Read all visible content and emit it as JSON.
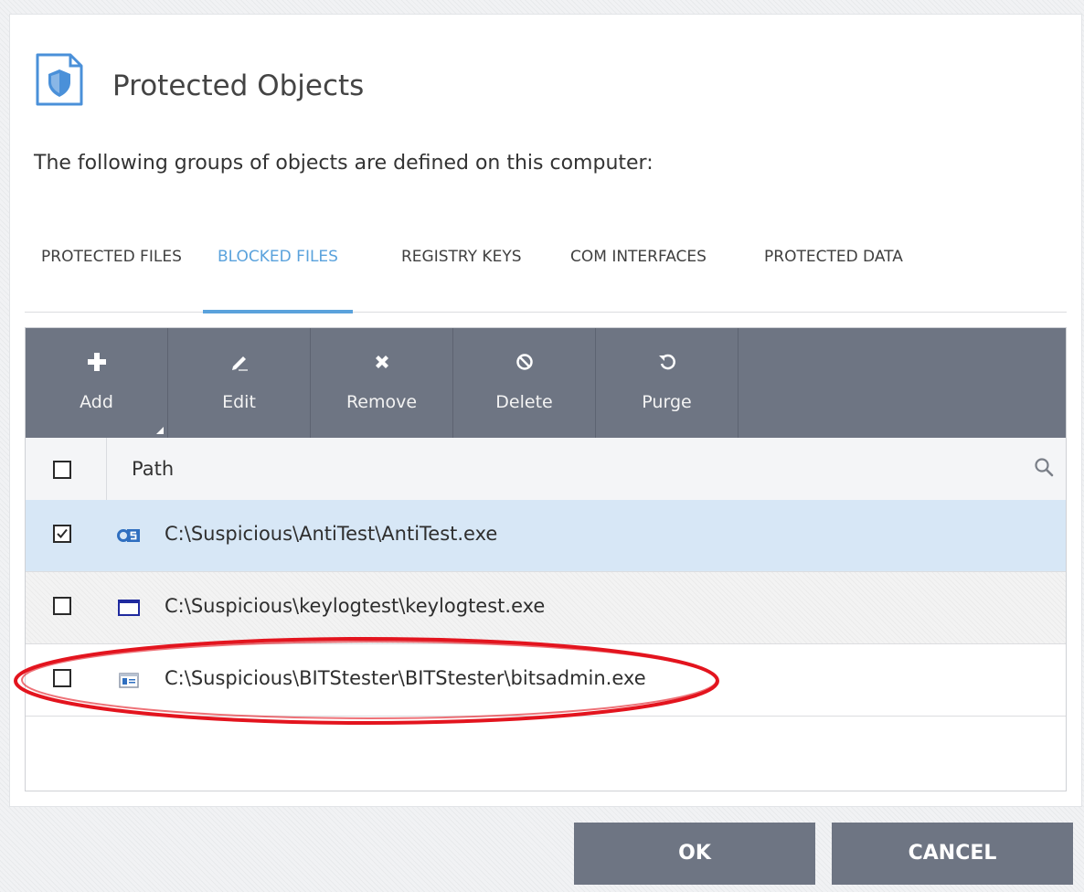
{
  "dialog": {
    "title": "Protected Objects",
    "subtitle": "The following groups of objects are defined on this computer:",
    "header_icon": "shield-document-icon"
  },
  "tabs": [
    {
      "label": "PROTECTED FILES",
      "active": false
    },
    {
      "label": "BLOCKED FILES",
      "active": true
    },
    {
      "label": "REGISTRY KEYS",
      "active": false
    },
    {
      "label": "COM INTERFACES",
      "active": false
    },
    {
      "label": "PROTECTED DATA",
      "active": false
    }
  ],
  "toolbar": {
    "buttons": [
      {
        "label": "Add",
        "icon": "plus-icon",
        "has_dropdown": true
      },
      {
        "label": "Edit",
        "icon": "pencil-icon"
      },
      {
        "label": "Remove",
        "icon": "x-icon"
      },
      {
        "label": "Delete",
        "icon": "block-icon"
      },
      {
        "label": "Purge",
        "icon": "refresh-icon"
      }
    ]
  },
  "table": {
    "column_header": "Path",
    "select_all_checked": false,
    "rows": [
      {
        "path": "C:\\Suspicious\\AntiTest\\AntiTest.exe",
        "checked": true,
        "icon": "exe-cs-icon"
      },
      {
        "path": "C:\\Suspicious\\keylogtest\\keylogtest.exe",
        "checked": false,
        "icon": "window-icon"
      },
      {
        "path": "C:\\Suspicious\\BITStester\\BITStester\\bitsadmin.exe",
        "checked": false,
        "icon": "app-window-icon"
      }
    ]
  },
  "footer": {
    "ok_label": "OK",
    "cancel_label": "CANCEL"
  },
  "colors": {
    "accent": "#5aa2dc",
    "toolbar": "#6e7583",
    "selected_row": "#d7e7f6",
    "highlight": "#e3141e"
  }
}
